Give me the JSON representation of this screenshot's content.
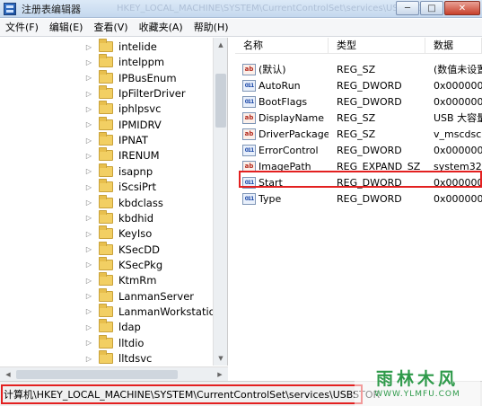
{
  "window": {
    "title": "注册表编辑器",
    "title_ghost": "HKEY_LOCAL_MACHINE\\SYSTEM\\CurrentControlSet\\services\\USBSTOR"
  },
  "menu": [
    "文件(F)",
    "编辑(E)",
    "查看(V)",
    "收藏夹(A)",
    "帮助(H)"
  ],
  "tree": [
    "intelide",
    "intelppm",
    "IPBusEnum",
    "IpFilterDriver",
    "iphlpsvc",
    "IPMIDRV",
    "IPNAT",
    "IRENUM",
    "isapnp",
    "iScsiPrt",
    "kbdclass",
    "kbdhid",
    "KeyIso",
    "KSecDD",
    "KSecPkg",
    "KtmRm",
    "LanmanServer",
    "LanmanWorkstation",
    "ldap",
    "lltdio",
    "lltdsvc"
  ],
  "values_header": {
    "name": "名称",
    "type": "类型",
    "data": "数据"
  },
  "values": [
    {
      "icon": "ab",
      "name": "(默认)",
      "type": "REG_SZ",
      "data": "(数值未设置)"
    },
    {
      "icon": "bin",
      "name": "AutoRun",
      "type": "REG_DWORD",
      "data": "0x000000"
    },
    {
      "icon": "bin",
      "name": "BootFlags",
      "type": "REG_DWORD",
      "data": "0x000000"
    },
    {
      "icon": "ab",
      "name": "DisplayName",
      "type": "REG_SZ",
      "data": "USB 大容量"
    },
    {
      "icon": "ab",
      "name": "DriverPackageId",
      "type": "REG_SZ",
      "data": "v_mscdsc"
    },
    {
      "icon": "bin",
      "name": "ErrorControl",
      "type": "REG_DWORD",
      "data": "0x000000"
    },
    {
      "icon": "ab",
      "name": "ImagePath",
      "type": "REG_EXPAND_SZ",
      "data": "system32"
    },
    {
      "icon": "bin",
      "name": "Start",
      "type": "REG_DWORD",
      "data": "0x000000"
    },
    {
      "icon": "bin",
      "name": "Type",
      "type": "REG_DWORD",
      "data": "0x000000"
    }
  ],
  "status": {
    "path": "计算机\\HKEY_LOCAL_MACHINE\\SYSTEM\\CurrentControlSet\\services\\USBSTOR"
  },
  "watermark": {
    "text": "雨林木风",
    "url": "WWW.YLMFU.COM"
  },
  "colors": {
    "highlight": "#e32020",
    "folder": "#f2cf63"
  }
}
